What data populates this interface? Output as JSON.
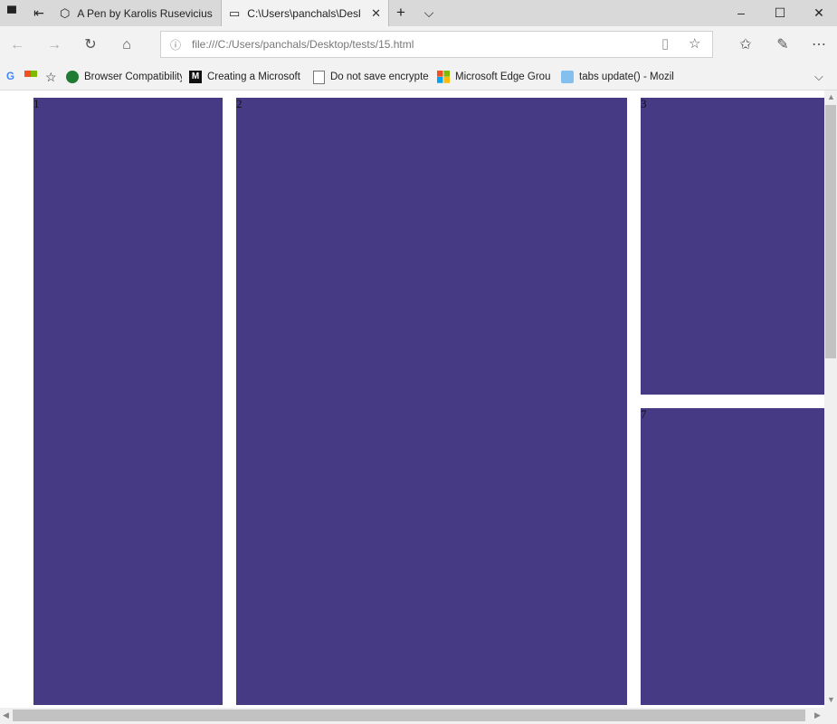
{
  "tabs": [
    {
      "title": "A Pen by Karolis Rusevicius",
      "active": false
    },
    {
      "title": "C:\\Users\\panchals\\Desk",
      "active": true
    }
  ],
  "tab_actions": {
    "new_tab": "+",
    "tab_list": "⌵"
  },
  "window_controls": {
    "minimize": "–",
    "maximize": "☐",
    "close": "✕"
  },
  "navigation": {
    "url": "file:///C:/Users/panchals/Desktop/tests/15.html"
  },
  "favorites": [
    {
      "label": "Browser Compatibility",
      "icon": "check-circle-icon"
    },
    {
      "label": "Creating a Microsoft",
      "icon": "m-logo-icon"
    },
    {
      "label": "Do not save encrypte",
      "icon": "document-icon"
    },
    {
      "label": "Microsoft Edge Grou",
      "icon": "windows-logo-icon"
    },
    {
      "label": "tabs update() - Mozil",
      "icon": "mdn-icon"
    }
  ],
  "boxes": [
    {
      "label": "1"
    },
    {
      "label": "2"
    },
    {
      "label": "3"
    },
    {
      "label": "7"
    }
  ],
  "colors": {
    "box": "#463a84",
    "chrome": "#f2f2f2",
    "tabbar": "#d9d9d9"
  }
}
